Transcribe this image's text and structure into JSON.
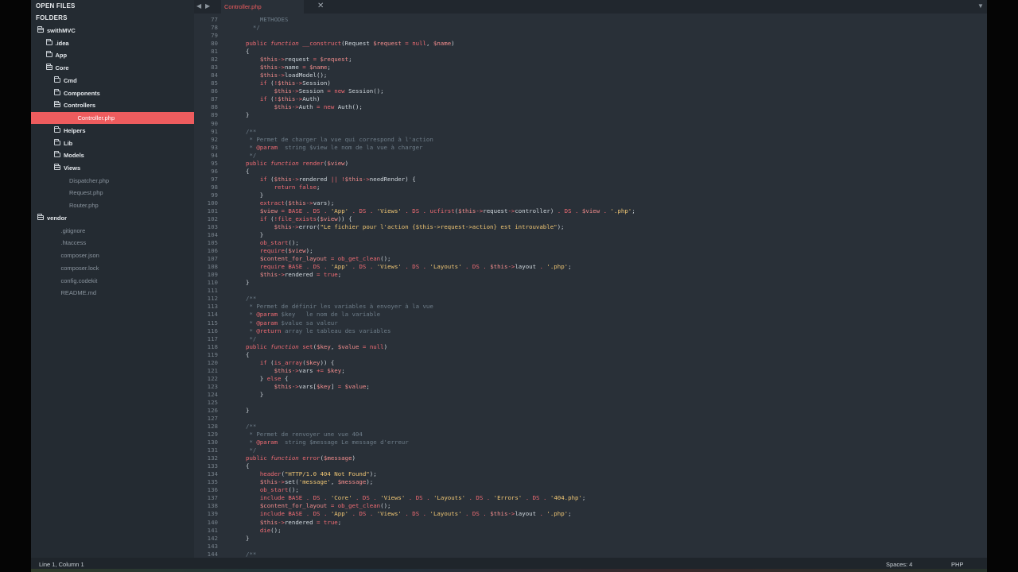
{
  "sidebar": {
    "open_files_label": "OPEN FILES",
    "folders_label": "FOLDERS",
    "tree": [
      {
        "label": "swithMVC",
        "kind": "folder",
        "open": true,
        "depth": 0
      },
      {
        "label": ".idea",
        "kind": "folder",
        "open": false,
        "depth": 1
      },
      {
        "label": "App",
        "kind": "folder",
        "open": false,
        "depth": 1
      },
      {
        "label": "Core",
        "kind": "folder",
        "open": true,
        "depth": 1
      },
      {
        "label": "Cmd",
        "kind": "folder",
        "open": false,
        "depth": 2
      },
      {
        "label": "Components",
        "kind": "folder",
        "open": false,
        "depth": 2
      },
      {
        "label": "Controllers",
        "kind": "folder",
        "open": true,
        "depth": 2
      },
      {
        "label": "Controller.php",
        "kind": "file",
        "depth": 3,
        "active": true
      },
      {
        "label": "Helpers",
        "kind": "folder",
        "open": false,
        "depth": 2
      },
      {
        "label": "Lib",
        "kind": "folder",
        "open": false,
        "depth": 2
      },
      {
        "label": "Models",
        "kind": "folder",
        "open": false,
        "depth": 2
      },
      {
        "label": "Views",
        "kind": "folder",
        "open": true,
        "depth": 2
      },
      {
        "label": "Dispatcher.php",
        "kind": "file",
        "depth": 2
      },
      {
        "label": "Request.php",
        "kind": "file",
        "depth": 2
      },
      {
        "label": "Router.php",
        "kind": "file",
        "depth": 2
      },
      {
        "label": "vendor",
        "kind": "folder",
        "open": true,
        "depth": 0
      },
      {
        "label": ".gitignore",
        "kind": "file",
        "depth": 1
      },
      {
        "label": ".htaccess",
        "kind": "file",
        "depth": 1
      },
      {
        "label": "composer.json",
        "kind": "file",
        "depth": 1
      },
      {
        "label": "composer.lock",
        "kind": "file",
        "depth": 1
      },
      {
        "label": "config.codekit",
        "kind": "file",
        "depth": 1
      },
      {
        "label": "README.md",
        "kind": "file",
        "depth": 1
      }
    ]
  },
  "tabbar": {
    "nav_left": "◀",
    "nav_right": "▶",
    "active_tab": "Controller.php",
    "close_glyph": "✕",
    "menu_glyph": "▼"
  },
  "editor": {
    "lines": [
      {
        "n": "77",
        "html": "    <span class='cmt'>METHODES</span>"
      },
      {
        "n": "78",
        "html": "  <span class='cmt'>*/</span>"
      },
      {
        "n": "79",
        "html": ""
      },
      {
        "n": "80",
        "html": "<span class='kw'>public</span> <span class='fn'>function</span> <span class='const'>__construct</span>(Request <span class='var'>$request</span> <span class='kw'>=</span> <span class='const'>null</span>, <span class='var'>$name</span>)"
      },
      {
        "n": "81",
        "html": "{"
      },
      {
        "n": "82",
        "html": "    <span class='var'>$this</span><span class='kw'>-></span>request <span class='kw'>=</span> <span class='var'>$request</span>;"
      },
      {
        "n": "83",
        "html": "    <span class='var'>$this</span><span class='kw'>-></span>name <span class='kw'>=</span> <span class='var'>$name</span>;"
      },
      {
        "n": "84",
        "html": "    <span class='var'>$this</span><span class='kw'>-></span>loadModel();"
      },
      {
        "n": "85",
        "html": "    <span class='kw'>if</span> (<span class='kw'>!</span><span class='var'>$this</span><span class='kw'>-></span>Session)"
      },
      {
        "n": "86",
        "html": "        <span class='var'>$this</span><span class='kw'>-></span>Session <span class='kw'>=</span> <span class='kw'>new</span> Session();"
      },
      {
        "n": "87",
        "html": "    <span class='kw'>if</span> (<span class='kw'>!</span><span class='var'>$this</span><span class='kw'>-></span>Auth)"
      },
      {
        "n": "88",
        "html": "        <span class='var'>$this</span><span class='kw'>-></span>Auth <span class='kw'>=</span> <span class='kw'>new</span> Auth();"
      },
      {
        "n": "89",
        "html": "}"
      },
      {
        "n": "90",
        "html": ""
      },
      {
        "n": "91",
        "html": "<span class='cmt'>/**</span>"
      },
      {
        "n": "92",
        "html": "<span class='cmt'> * Permet de charger la vue qui correspond à l'action</span>"
      },
      {
        "n": "93",
        "html": "<span class='cmt'> * </span><span class='kw'>@param</span><span class='cmt'>  string $view le nom de la vue à charger</span>"
      },
      {
        "n": "94",
        "html": "<span class='cmt'> */</span>"
      },
      {
        "n": "95",
        "html": "<span class='kw'>public</span> <span class='fn'>function</span> <span class='const'>render</span>(<span class='var'>$view</span>)"
      },
      {
        "n": "96",
        "html": "{"
      },
      {
        "n": "97",
        "html": "    <span class='kw'>if</span> (<span class='var'>$this</span><span class='kw'>-></span>rendered <span class='kw'>||</span> <span class='kw'>!</span><span class='var'>$this</span><span class='kw'>-></span>needRender) {"
      },
      {
        "n": "98",
        "html": "        <span class='kw'>return</span> <span class='const'>false</span>;"
      },
      {
        "n": "99",
        "html": "    }"
      },
      {
        "n": "100",
        "html": "    <span class='const'>extract</span>(<span class='var'>$this</span><span class='kw'>-></span>vars);"
      },
      {
        "n": "101",
        "html": "    <span class='var'>$view</span> <span class='kw'>=</span> <span class='const'>BASE</span> <span class='kw'>.</span> <span class='const'>DS</span> <span class='kw'>.</span> <span class='str'>'App'</span> <span class='kw'>.</span> <span class='const'>DS</span> <span class='kw'>.</span> <span class='str'>'Views'</span> <span class='kw'>.</span> <span class='const'>DS</span> <span class='kw'>.</span> <span class='const'>ucfirst</span>(<span class='var'>$this</span><span class='kw'>-></span>request<span class='kw'>-></span>controller) <span class='kw'>.</span> <span class='const'>DS</span> <span class='kw'>.</span> <span class='var'>$view</span> <span class='kw'>.</span> <span class='str'>'.php'</span>;"
      },
      {
        "n": "102",
        "html": "    <span class='kw'>if</span> (<span class='kw'>!</span><span class='const'>file_exists</span>(<span class='var'>$view</span>)) {"
      },
      {
        "n": "103",
        "html": "        <span class='var'>$this</span><span class='kw'>-></span>error(<span class='str'>\"Le fichier pour l'action {$this->request->action} est introuvable\"</span>);"
      },
      {
        "n": "104",
        "html": "    }"
      },
      {
        "n": "105",
        "html": "    <span class='const'>ob_start</span>();"
      },
      {
        "n": "106",
        "html": "    <span class='kw'>require</span>(<span class='var'>$view</span>);"
      },
      {
        "n": "107",
        "html": "    <span class='var'>$content_for_layout</span> <span class='kw'>=</span> <span class='const'>ob_get_clean</span>();"
      },
      {
        "n": "108",
        "html": "    <span class='kw'>require</span> <span class='const'>BASE</span> <span class='kw'>.</span> <span class='const'>DS</span> <span class='kw'>.</span> <span class='str'>'App'</span> <span class='kw'>.</span> <span class='const'>DS</span> <span class='kw'>.</span> <span class='str'>'Views'</span> <span class='kw'>.</span> <span class='const'>DS</span> <span class='kw'>.</span> <span class='str'>'Layouts'</span> <span class='kw'>.</span> <span class='const'>DS</span> <span class='kw'>.</span> <span class='var'>$this</span><span class='kw'>-></span>layout <span class='kw'>.</span> <span class='str'>'.php'</span>;"
      },
      {
        "n": "109",
        "html": "    <span class='var'>$this</span><span class='kw'>-></span>rendered <span class='kw'>=</span> <span class='const'>true</span>;"
      },
      {
        "n": "110",
        "html": "}"
      },
      {
        "n": "111",
        "html": ""
      },
      {
        "n": "112",
        "html": "<span class='cmt'>/**</span>"
      },
      {
        "n": "113",
        "html": "<span class='cmt'> * Permet de définir les variables à envoyer à la vue</span>"
      },
      {
        "n": "114",
        "html": "<span class='cmt'> * </span><span class='kw'>@param</span><span class='cmt'> $key   le nom de la variable</span>"
      },
      {
        "n": "115",
        "html": "<span class='cmt'> * </span><span class='kw'>@param</span><span class='cmt'> $value sa valeur</span>"
      },
      {
        "n": "116",
        "html": "<span class='cmt'> * </span><span class='kw'>@return</span><span class='cmt'> array le tableau des variables</span>"
      },
      {
        "n": "117",
        "html": "<span class='cmt'> */</span>"
      },
      {
        "n": "118",
        "html": "<span class='kw'>public</span> <span class='fn'>function</span> <span class='const'>set</span>(<span class='var'>$key</span>, <span class='var'>$value</span> <span class='kw'>=</span> <span class='const'>null</span>)"
      },
      {
        "n": "119",
        "html": "{"
      },
      {
        "n": "120",
        "html": "    <span class='kw'>if</span> (<span class='const'>is_array</span>(<span class='var'>$key</span>)) {"
      },
      {
        "n": "121",
        "html": "        <span class='var'>$this</span><span class='kw'>-></span>vars <span class='kw'>+=</span> <span class='var'>$key</span>;"
      },
      {
        "n": "122",
        "html": "    } <span class='kw'>else</span> {"
      },
      {
        "n": "123",
        "html": "        <span class='var'>$this</span><span class='kw'>-></span>vars[<span class='var'>$key</span>] <span class='kw'>=</span> <span class='var'>$value</span>;"
      },
      {
        "n": "124",
        "html": "    }"
      },
      {
        "n": "125",
        "html": ""
      },
      {
        "n": "126",
        "html": "}"
      },
      {
        "n": "127",
        "html": ""
      },
      {
        "n": "128",
        "html": "<span class='cmt'>/**</span>"
      },
      {
        "n": "129",
        "html": "<span class='cmt'> * Permet de renvoyer une vue 404</span>"
      },
      {
        "n": "130",
        "html": "<span class='cmt'> * </span><span class='kw'>@param</span><span class='cmt'>  string $message Le message d'erreur</span>"
      },
      {
        "n": "131",
        "html": "<span class='cmt'> */</span>"
      },
      {
        "n": "132",
        "html": "<span class='kw'>public</span> <span class='fn'>function</span> <span class='const'>error</span>(<span class='var'>$message</span>)"
      },
      {
        "n": "133",
        "html": "{"
      },
      {
        "n": "134",
        "html": "    <span class='const'>header</span>(<span class='str'>\"HTTP/1.0 404 Not Found\"</span>);"
      },
      {
        "n": "135",
        "html": "    <span class='var'>$this</span><span class='kw'>-></span>set(<span class='str'>'message'</span>, <span class='var'>$message</span>);"
      },
      {
        "n": "136",
        "html": "    <span class='const'>ob_start</span>();"
      },
      {
        "n": "137",
        "html": "    <span class='kw'>include</span> <span class='const'>BASE</span> <span class='kw'>.</span> <span class='const'>DS</span> <span class='kw'>.</span> <span class='str'>'Core'</span> <span class='kw'>.</span> <span class='const'>DS</span> <span class='kw'>.</span> <span class='str'>'Views'</span> <span class='kw'>.</span> <span class='const'>DS</span> <span class='kw'>.</span> <span class='str'>'Layouts'</span> <span class='kw'>.</span> <span class='const'>DS</span> <span class='kw'>.</span> <span class='str'>'Errors'</span> <span class='kw'>.</span> <span class='const'>DS</span> <span class='kw'>.</span> <span class='str'>'404.php'</span>;"
      },
      {
        "n": "138",
        "html": "    <span class='var'>$content_for_layout</span> <span class='kw'>=</span> <span class='const'>ob_get_clean</span>();"
      },
      {
        "n": "139",
        "html": "    <span class='kw'>include</span> <span class='const'>BASE</span> <span class='kw'>.</span> <span class='const'>DS</span> <span class='kw'>.</span> <span class='str'>'App'</span> <span class='kw'>.</span> <span class='const'>DS</span> <span class='kw'>.</span> <span class='str'>'Views'</span> <span class='kw'>.</span> <span class='const'>DS</span> <span class='kw'>.</span> <span class='str'>'Layouts'</span> <span class='kw'>.</span> <span class='const'>DS</span> <span class='kw'>.</span> <span class='var'>$this</span><span class='kw'>-></span>layout <span class='kw'>.</span> <span class='str'>'.php'</span>;"
      },
      {
        "n": "140",
        "html": "    <span class='var'>$this</span><span class='kw'>-></span>rendered <span class='kw'>=</span> <span class='const'>true</span>;"
      },
      {
        "n": "141",
        "html": "    <span class='const'>die</span>();"
      },
      {
        "n": "142",
        "html": "}"
      },
      {
        "n": "143",
        "html": ""
      },
      {
        "n": "144",
        "html": "<span class='cmt'>/**</span>"
      }
    ]
  },
  "status": {
    "position": "Line 1, Column 1",
    "indent": "Spaces: 4",
    "syntax": "PHP"
  },
  "colors": {
    "accent": "#ee5c5e",
    "editor_bg": "#293038",
    "sidebar_bg": "#242b32"
  }
}
